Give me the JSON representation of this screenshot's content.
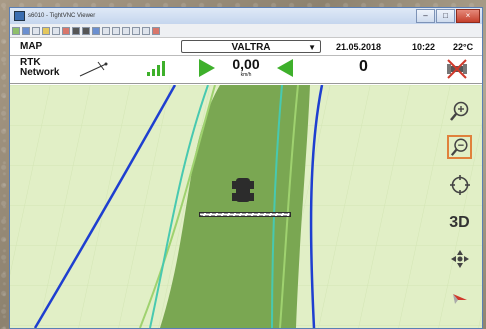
{
  "window": {
    "title": "s6010 - TightVNC Viewer",
    "controls": [
      "minimize",
      "maximize",
      "close"
    ]
  },
  "toolbar": {
    "icons": [
      "new-connection-icon",
      "save-icon",
      "options-icon",
      "refresh-icon",
      "pause-icon",
      "ctrl-alt-del-icon",
      "ctrl-key-icon",
      "alt-key-icon",
      "fullscreen-icon",
      "zoom-in-icon",
      "zoom-out-icon",
      "zoom-fit-icon",
      "zoom-100-icon",
      "info-icon",
      "close-connection-icon"
    ]
  },
  "header": {
    "mode": "MAP",
    "vehicle": "VALTRA",
    "date": "21.05.2018",
    "time": "10:22",
    "temperature": "22°C"
  },
  "status": {
    "correction_line1": "RTK",
    "correction_line2": "Network",
    "speed": "0,00",
    "speed_unit": "km/h",
    "count": "0",
    "icons": [
      "antenna-icon",
      "signal-strength-icon",
      "forward-arrow-icon",
      "back-arrow-icon",
      "satellite-off-icon"
    ],
    "colors": {
      "arrow": "#3eb02b",
      "field": "#7aa752",
      "boundary": "#1e3fd0",
      "guidance": "#48c9b0"
    }
  },
  "map_controls": {
    "view_3d_label": "3D",
    "icons": [
      "zoom-in-icon",
      "zoom-out-icon",
      "center-icon",
      "pan-icon",
      "north-arrow-icon"
    ],
    "selected": "zoom-out-icon"
  }
}
